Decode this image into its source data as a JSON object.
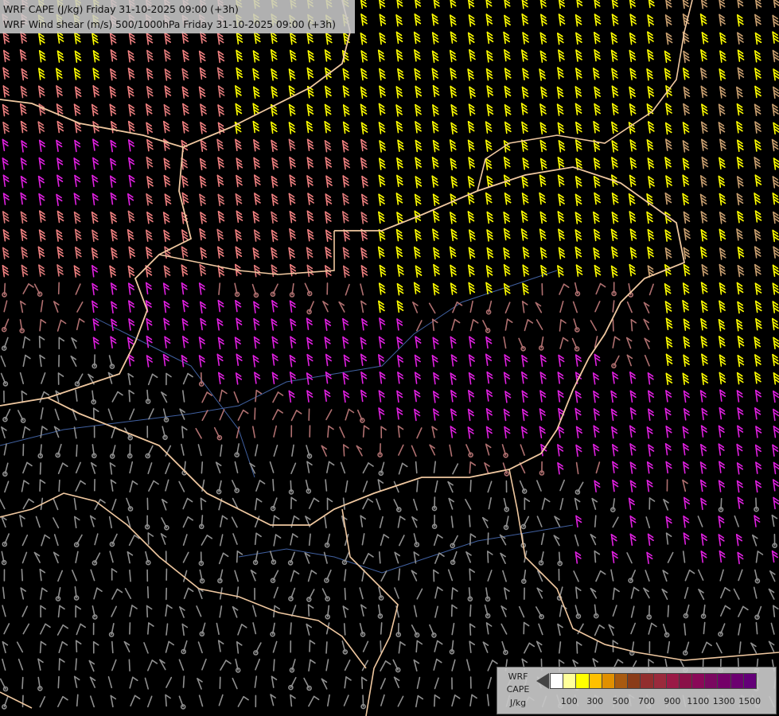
{
  "header": {
    "line1": "WRF CAPE (J/kg) Friday 31-10-2025 09:00 (+3h)",
    "line2": "WRF Wind shear (m/s) 500/1000hPa Friday 31-10-2025 09:00 (+3h)"
  },
  "legend": {
    "title_line1": "WRF",
    "title_line2": "CAPE",
    "unit": "J/kg",
    "swatch_colors": [
      "#ffffff",
      "#ffff9a",
      "#ffff00",
      "#ffc000",
      "#e09000",
      "#a85a10",
      "#8a3c18",
      "#922e2e",
      "#9a2a3c",
      "#9a1a46",
      "#8a1048",
      "#8a0858",
      "#7a0860",
      "#740068",
      "#6c0070",
      "#640078"
    ],
    "ticks": [
      {
        "label": "100",
        "index": 1
      },
      {
        "label": "300",
        "index": 3
      },
      {
        "label": "500",
        "index": 5
      },
      {
        "label": "700",
        "index": 7
      },
      {
        "label": "900",
        "index": 9
      },
      {
        "label": "1100",
        "index": 11
      },
      {
        "label": "1300",
        "index": 13
      },
      {
        "label": "1500",
        "index": 15
      }
    ]
  },
  "map": {
    "barb_colors": {
      "yellow": "#ffff00",
      "tan": "#caa070",
      "salmon": "#f08080",
      "pink": "#e07a7a",
      "magenta": "#e020e0",
      "brown": "#b07070",
      "gray": "#909090"
    },
    "border_color": "#f0c8a0",
    "river_color": "#4060a0"
  }
}
